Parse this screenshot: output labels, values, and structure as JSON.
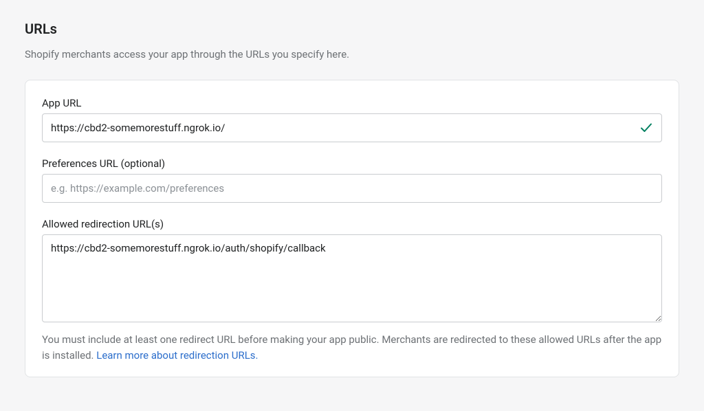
{
  "section": {
    "title": "URLs",
    "description": "Shopify merchants access your app through the URLs you specify here."
  },
  "fields": {
    "appUrl": {
      "label": "App URL",
      "value": "https://cbd2-somemorestuff.ngrok.io/"
    },
    "preferencesUrl": {
      "label": "Preferences URL (optional)",
      "placeholder": "e.g. https://example.com/preferences",
      "value": ""
    },
    "allowedRedirectionUrls": {
      "label": "Allowed redirection URL(s)",
      "value": "https://cbd2-somemorestuff.ngrok.io/auth/shopify/callback"
    }
  },
  "helpText": {
    "prefix": "You must include at least one redirect URL before making your app public. Merchants are redirected to these allowed URLs after the app is installed. ",
    "linkText": "Learn more about redirection URLs.",
    "suffix": ""
  }
}
